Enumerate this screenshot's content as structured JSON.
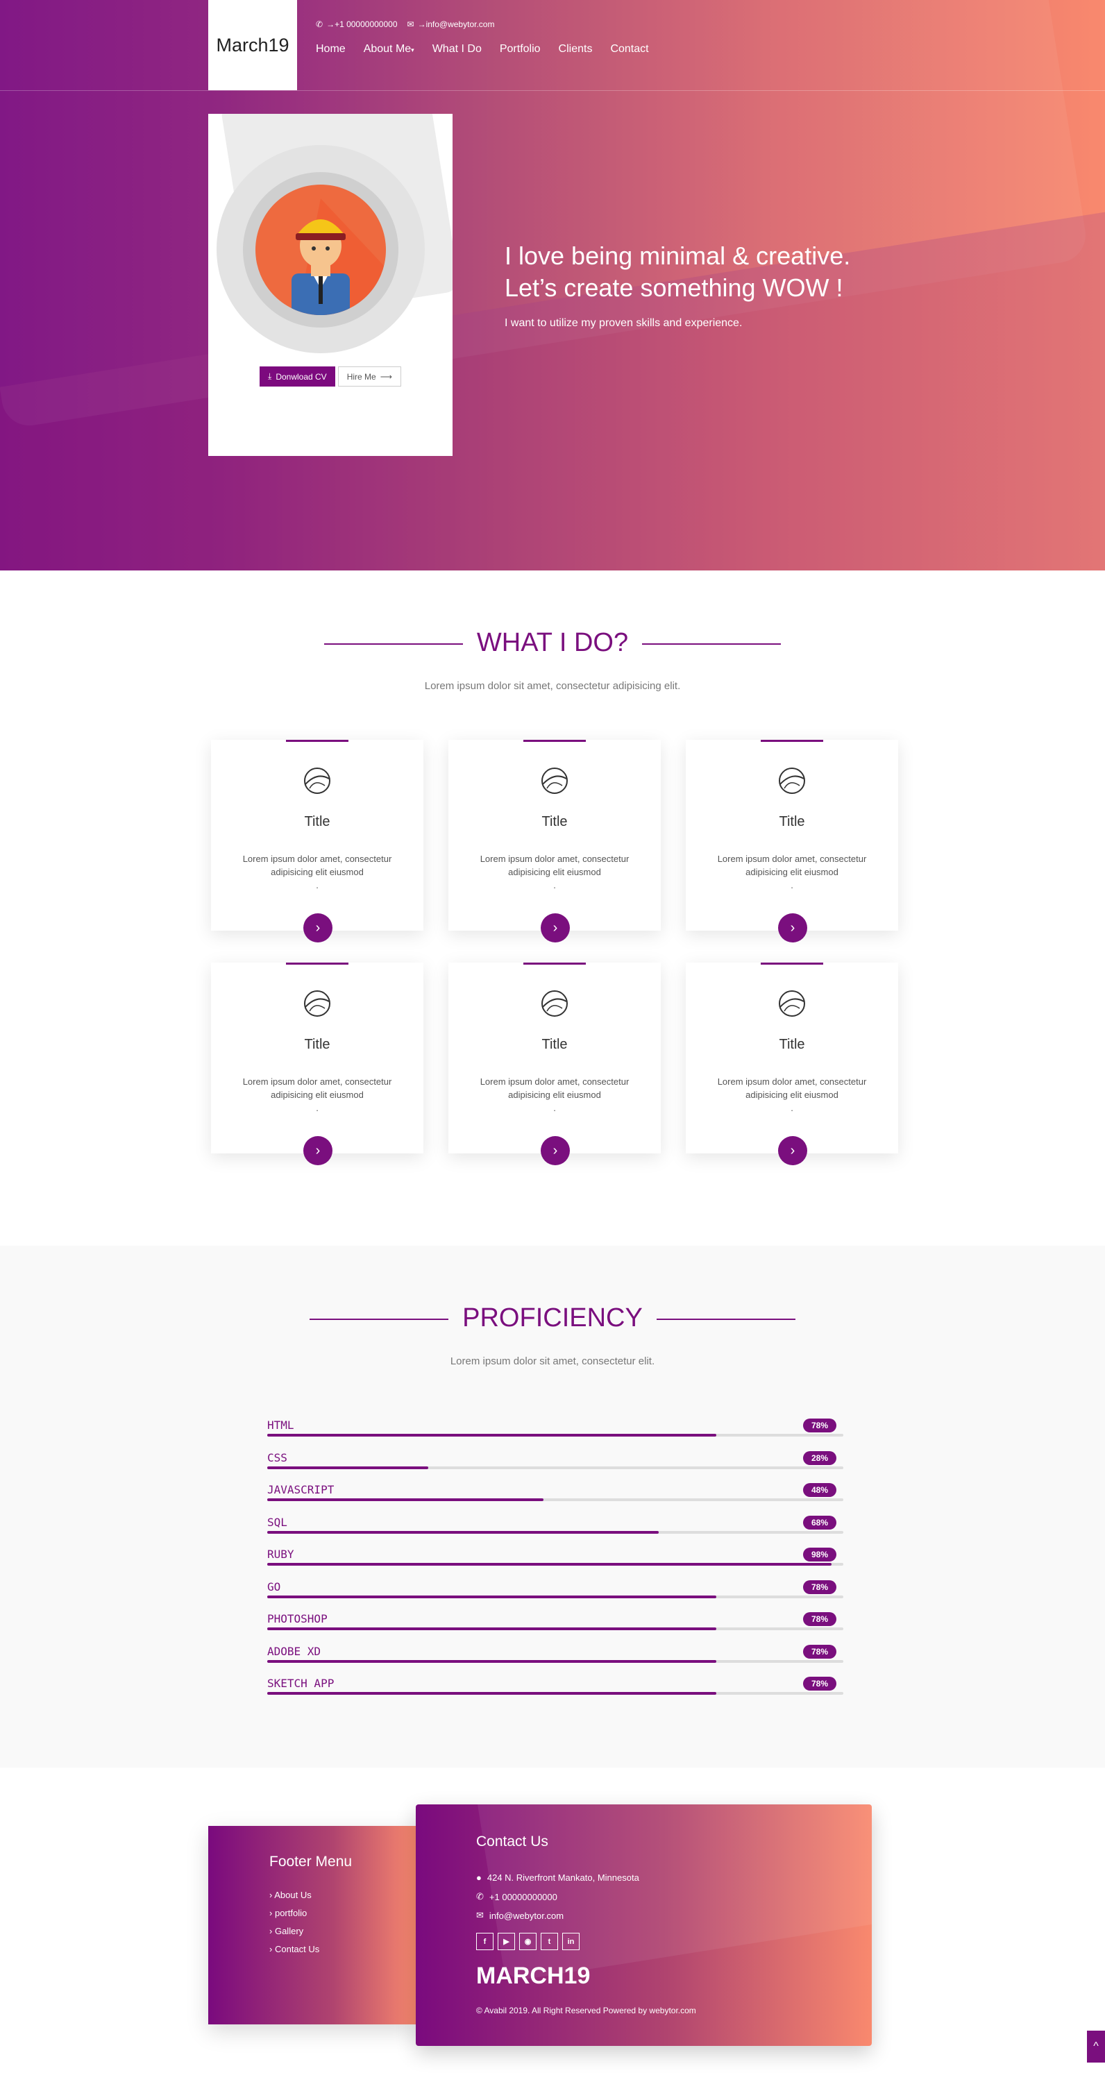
{
  "header": {
    "logo": "March19",
    "phone": "→+1 00000000000",
    "email": "→info@webytor.com",
    "menu": [
      "Home",
      "About Me",
      "What I Do",
      "Portfolio",
      "Clients",
      "Contact"
    ]
  },
  "hero": {
    "line1": "I love being minimal & creative.",
    "line2": "Let’s create something WOW !",
    "subtitle": "I want to utilize my proven skills and experience.",
    "download_label": "Donwload CV",
    "hire_label": "Hire Me"
  },
  "services": {
    "title": "WHAT I DO?",
    "subtitle": "Lorem ipsum dolor sit amet, consectetur adipisicing elit.",
    "cards": [
      {
        "title": "Title",
        "desc": "Lorem ipsum dolor amet, consectetur adipisicing elit eiusmod",
        "dot": "."
      },
      {
        "title": "Title",
        "desc": "Lorem ipsum dolor amet, consectetur adipisicing elit eiusmod",
        "dot": "."
      },
      {
        "title": "Title",
        "desc": "Lorem ipsum dolor amet, consectetur adipisicing elit eiusmod",
        "dot": "."
      },
      {
        "title": "Title",
        "desc": "Lorem ipsum dolor amet, consectetur adipisicing elit eiusmod",
        "dot": "."
      },
      {
        "title": "Title",
        "desc": "Lorem ipsum dolor amet, consectetur adipisicing elit eiusmod",
        "dot": "."
      },
      {
        "title": "Title",
        "desc": "Lorem ipsum dolor amet, consectetur adipisicing elit eiusmod",
        "dot": "."
      }
    ]
  },
  "proficiency": {
    "title": "PROFICIENCY",
    "subtitle": "Lorem ipsum dolor sit amet, consectetur elit.",
    "skills": [
      {
        "name": "HTML",
        "percent": 78,
        "label": "78%"
      },
      {
        "name": "CSS",
        "percent": 28,
        "label": "28%"
      },
      {
        "name": "JAVASCRIPT",
        "percent": 48,
        "label": "48%"
      },
      {
        "name": "SQL",
        "percent": 68,
        "label": "68%"
      },
      {
        "name": "RUBY",
        "percent": 98,
        "label": "98%"
      },
      {
        "name": "GO",
        "percent": 78,
        "label": "78%"
      },
      {
        "name": "PHOTOSHOP",
        "percent": 78,
        "label": "78%"
      },
      {
        "name": "ADOBE XD",
        "percent": 78,
        "label": "78%"
      },
      {
        "name": "SKETCH APP",
        "percent": 78,
        "label": "78%"
      }
    ]
  },
  "footer": {
    "menu_title": "Footer Menu",
    "menu_items": [
      "About Us",
      "portfolio",
      "Gallery",
      "Contact Us"
    ],
    "contact_title": "Contact Us",
    "address": "424 N. Riverfront Mankato, Minnesota",
    "phone": "+1 00000000000",
    "email": "info@webytor.com",
    "socials": [
      "facebook-icon",
      "youtube-icon",
      "instagram-icon",
      "twitter-icon",
      "linkedin-icon"
    ],
    "brand": "MARCH19",
    "copyright": "© Avabil 2019. All Right Reserved Powered by webytor.com"
  },
  "colors": {
    "accent": "#7a0f7e",
    "gradient_start": "#7a0a7e",
    "gradient_end": "#f9896e"
  }
}
